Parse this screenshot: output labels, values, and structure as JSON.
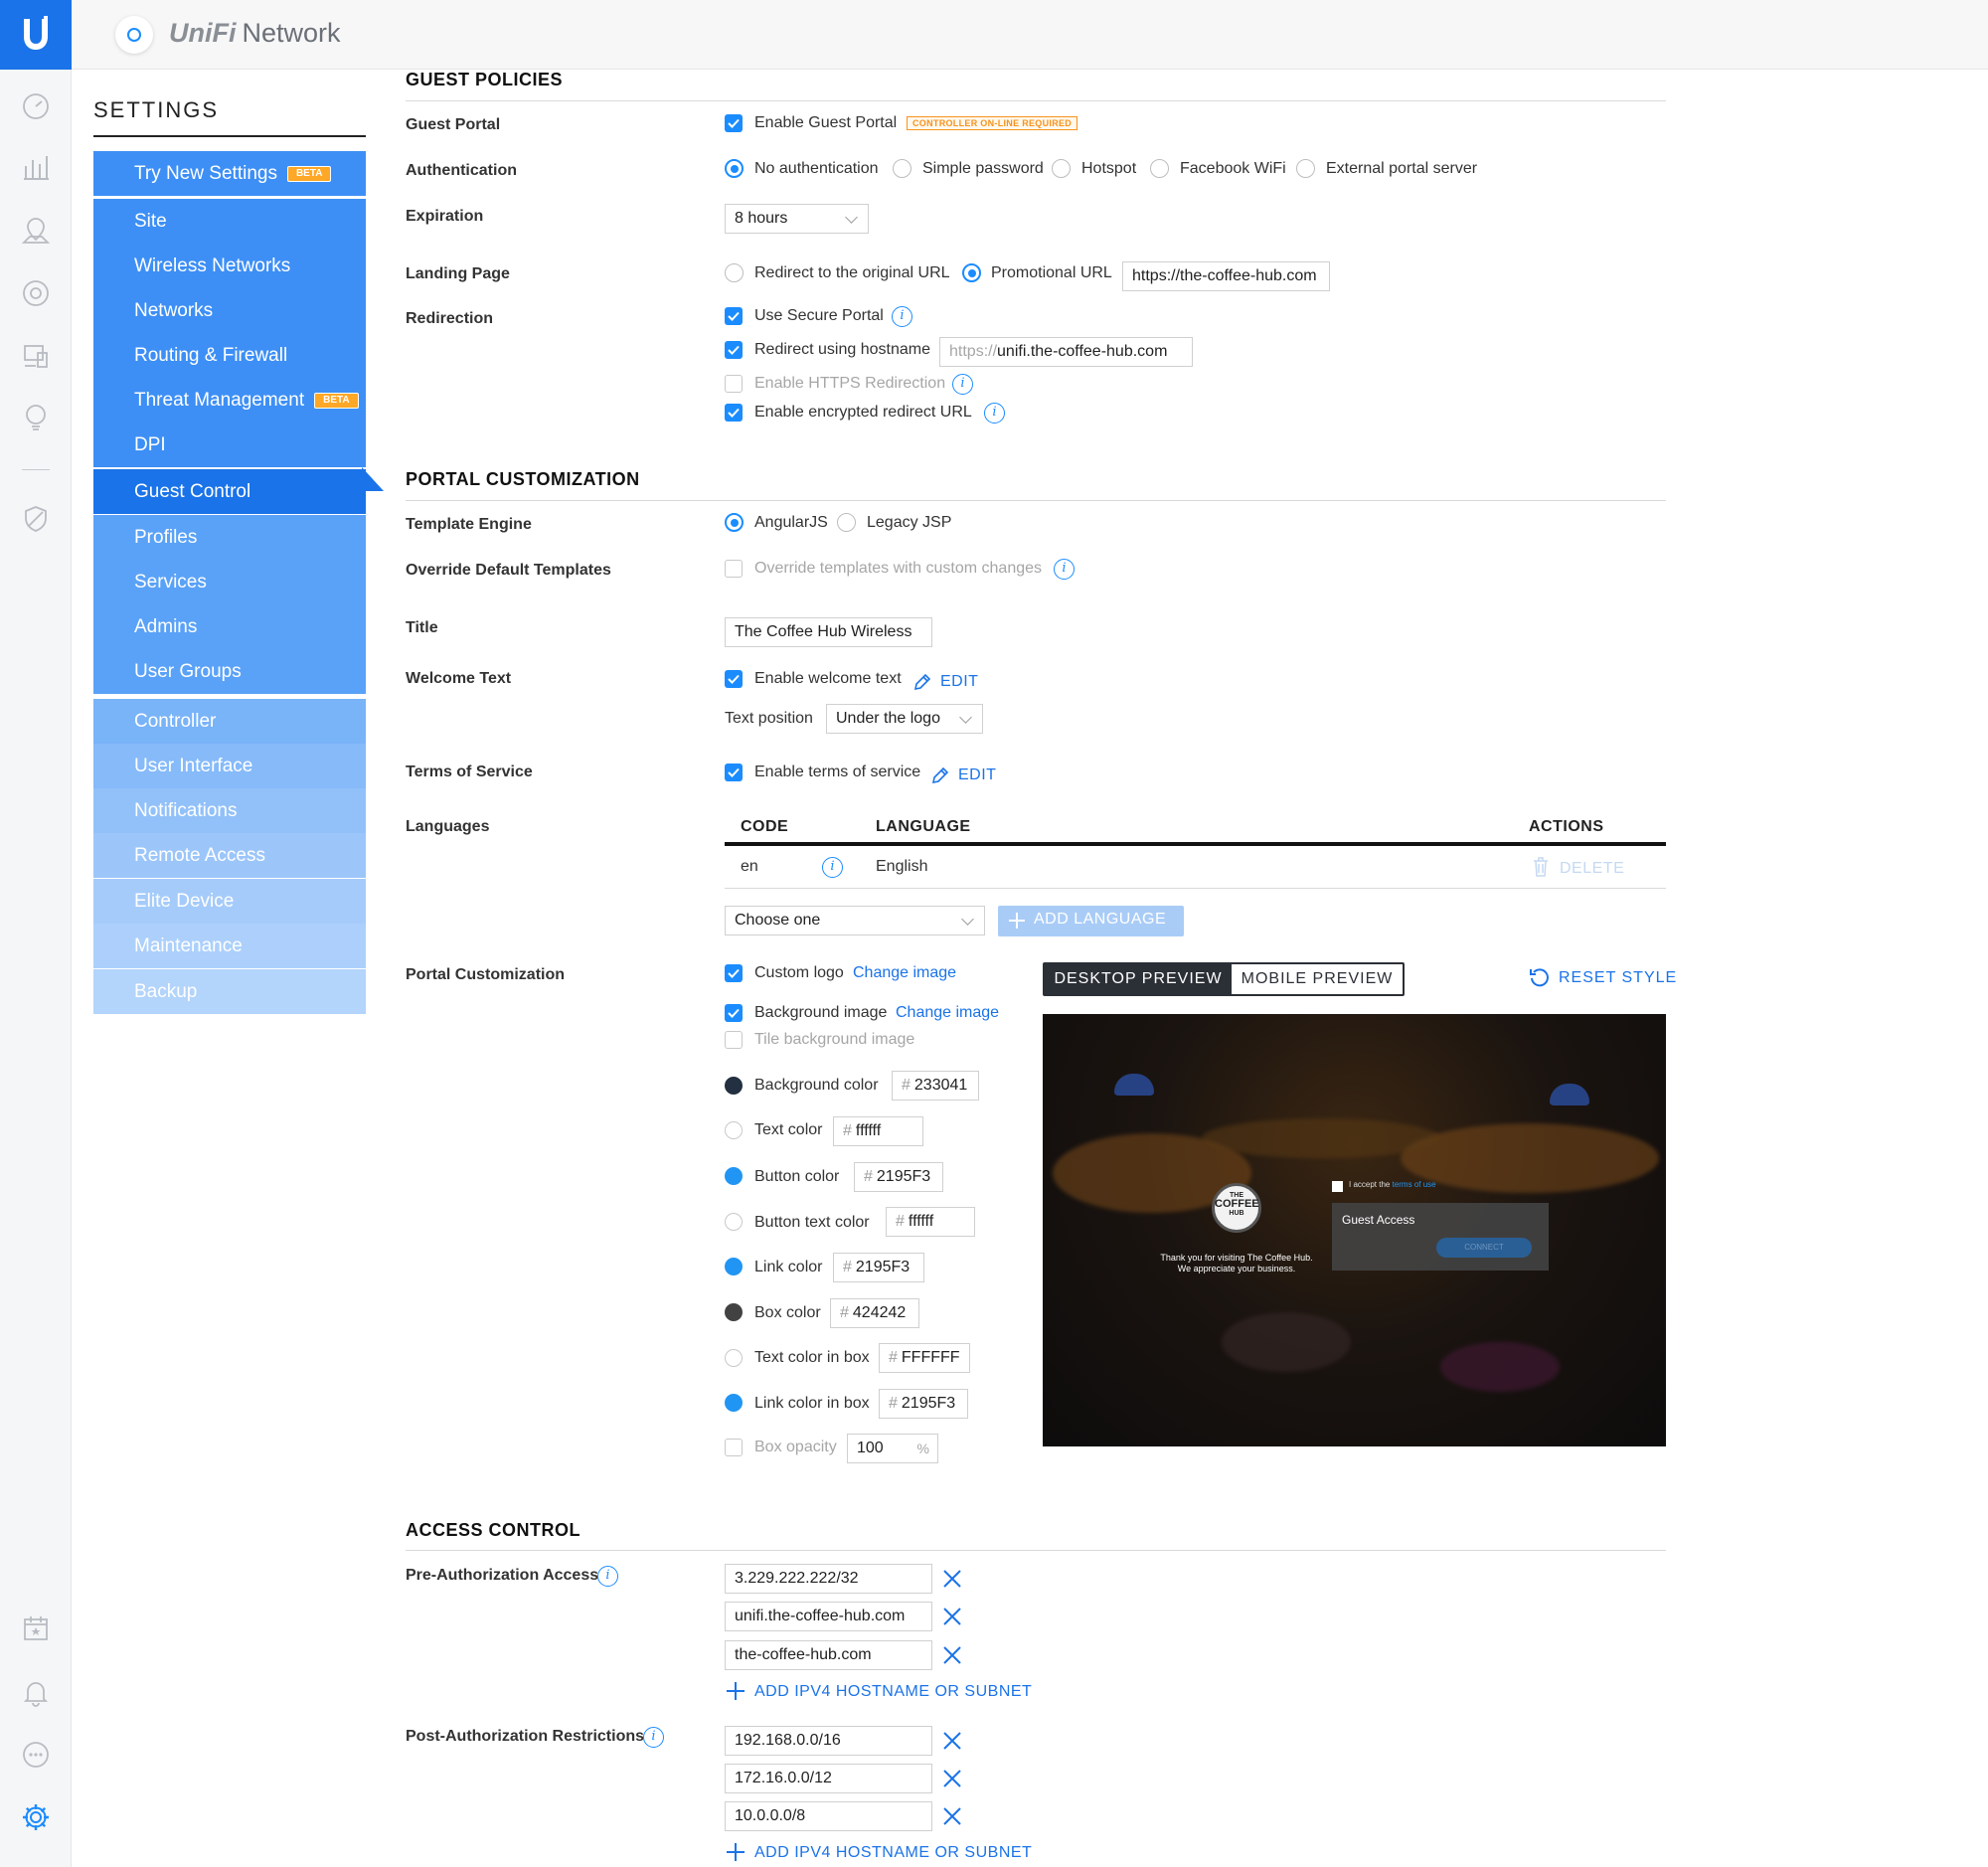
{
  "app": {
    "brand_prefix": "UniFi",
    "brand_name": "Network"
  },
  "sidebar": {
    "title": "SETTINGS",
    "try_new": {
      "label": "Try New Settings",
      "badge": "BETA"
    },
    "items": [
      {
        "label": "Site"
      },
      {
        "label": "Wireless Networks"
      },
      {
        "label": "Networks"
      },
      {
        "label": "Routing & Firewall"
      },
      {
        "label": "Threat Management",
        "badge": "BETA"
      },
      {
        "label": "DPI"
      },
      {
        "label": "Guest Control"
      },
      {
        "label": "Profiles"
      },
      {
        "label": "Services"
      },
      {
        "label": "Admins"
      },
      {
        "label": "User Groups"
      }
    ],
    "items2": [
      {
        "label": "Controller"
      },
      {
        "label": "User Interface"
      },
      {
        "label": "Notifications"
      },
      {
        "label": "Remote Access"
      },
      {
        "label": "Elite Device"
      },
      {
        "label": "Maintenance"
      },
      {
        "label": "Backup"
      }
    ],
    "colors": {
      "primary": "#1a73e8",
      "active": "#1a73e8"
    }
  },
  "guest_policies": {
    "title": "GUEST POLICIES",
    "guest_portal": {
      "label": "Guest Portal",
      "option": "Enable Guest Portal",
      "tag": "CONTROLLER ON-LINE REQUIRED"
    },
    "authentication": {
      "label": "Authentication",
      "options": [
        "No authentication",
        "Simple password",
        "Hotspot",
        "Facebook WiFi",
        "External portal server"
      ]
    },
    "expiration": {
      "label": "Expiration",
      "value": "8 hours"
    },
    "landing": {
      "label": "Landing Page",
      "opt1": "Redirect to the original URL",
      "opt2": "Promotional URL",
      "url": "https://the-coffee-hub.com"
    },
    "redirection": {
      "label": "Redirection",
      "secure": "Use Secure Portal",
      "hostname": "Redirect using hostname",
      "hostname_prefix": "https://",
      "hostname_value": "unifi.the-coffee-hub.com",
      "https": "Enable HTTPS Redirection",
      "encrypted": "Enable encrypted redirect URL"
    }
  },
  "portal": {
    "title": "PORTAL CUSTOMIZATION",
    "template": {
      "label": "Template Engine",
      "opt1": "AngularJS",
      "opt2": "Legacy JSP"
    },
    "override": {
      "label": "Override Default Templates",
      "option": "Override templates with custom changes"
    },
    "title_field": {
      "label": "Title",
      "value": "The Coffee Hub Wireless"
    },
    "welcome": {
      "label": "Welcome Text",
      "option": "Enable welcome text",
      "edit": "EDIT",
      "position_label": "Text position",
      "position_value": "Under the logo"
    },
    "tos": {
      "label": "Terms of Service",
      "option": "Enable terms of service",
      "edit": "EDIT"
    },
    "languages": {
      "label": "Languages",
      "col_code": "CODE",
      "col_language": "LANGUAGE",
      "col_actions": "ACTIONS",
      "rows": [
        {
          "code": "en",
          "language": "English",
          "action": "DELETE"
        }
      ],
      "choose": "Choose one",
      "add": "ADD LANGUAGE"
    },
    "custom": {
      "label": "Portal Customization",
      "logo": "Custom logo",
      "change_image": "Change image",
      "bg_image": "Background image",
      "tile": "Tile background image",
      "colors": [
        {
          "label": "Background color",
          "value": "233041",
          "swatch": "#233041"
        },
        {
          "label": "Text color",
          "value": "ffffff",
          "swatch": "#ffffff"
        },
        {
          "label": "Button color",
          "value": "2195F3",
          "swatch": "#2195F3"
        },
        {
          "label": "Button text color",
          "value": "ffffff",
          "swatch": "#ffffff"
        },
        {
          "label": "Link color",
          "value": "2195F3",
          "swatch": "#2195F3"
        },
        {
          "label": "Box color",
          "value": "424242",
          "swatch": "#424242"
        },
        {
          "label": "Text color in box",
          "value": "FFFFFF",
          "swatch": "#ffffff"
        },
        {
          "label": "Link color in box",
          "value": "2195F3",
          "swatch": "#2195F3"
        }
      ],
      "opacity_label": "Box opacity",
      "opacity_value": "100",
      "opacity_unit": "%",
      "desktop_tab": "DESKTOP PREVIEW",
      "mobile_tab": "MOBILE PREVIEW",
      "reset": "RESET STYLE",
      "preview": {
        "logo_top": "THE",
        "logo_mid": "COFFEE",
        "logo_bot": "HUB",
        "welcome": "Thank you for visiting The Coffee Hub. We appreciate your business.",
        "accept": "I accept the",
        "terms_link": "terms of use",
        "box_title": "Guest Access",
        "connect": "CONNECT"
      }
    }
  },
  "access": {
    "title": "ACCESS CONTROL",
    "pre": {
      "label": "Pre-Authorization Access",
      "entries": [
        "3.229.222.222/32",
        "unifi.the-coffee-hub.com",
        "the-coffee-hub.com"
      ],
      "add": "ADD IPV4 HOSTNAME OR SUBNET"
    },
    "post": {
      "label": "Post-Authorization Restrictions",
      "entries": [
        "192.168.0.0/16",
        "172.16.0.0/12",
        "10.0.0.0/8"
      ],
      "add": "ADD IPV4 HOSTNAME OR SUBNET"
    }
  }
}
